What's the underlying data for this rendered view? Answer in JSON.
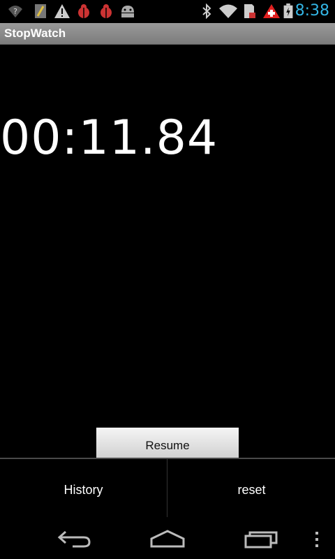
{
  "status_bar": {
    "time": "8:38",
    "icons": [
      "wifi-question-icon",
      "sim-icon",
      "warning-icon",
      "bug-icon",
      "bug-icon",
      "android-icon",
      "bluetooth-icon",
      "wifi-icon",
      "sd-card-icon",
      "alert-plus-icon",
      "battery-charging-icon"
    ],
    "time_color": "#33b5e5"
  },
  "title_bar": {
    "title": "StopWatch"
  },
  "timer": {
    "display": "00:11.84"
  },
  "controls": {
    "resume_label": "Resume"
  },
  "action_bar": {
    "history_label": "History",
    "reset_label": "reset"
  },
  "nav_bar": {
    "icons": [
      "back-icon",
      "home-icon",
      "recent-apps-icon",
      "overflow-menu-icon"
    ]
  }
}
